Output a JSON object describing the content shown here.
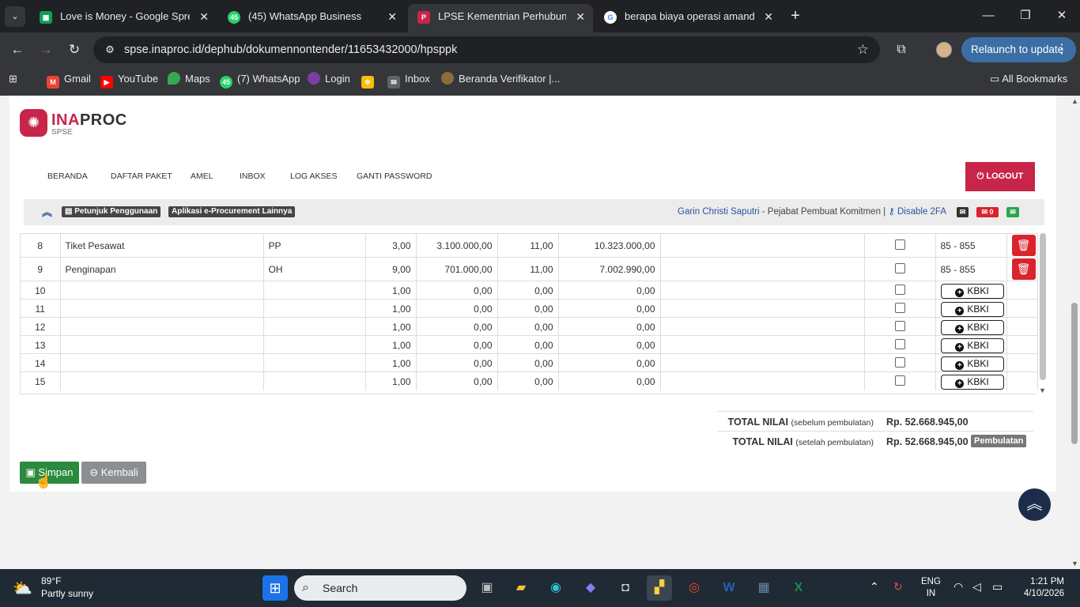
{
  "browser": {
    "tabs": [
      {
        "title": "Love is Money - Google Spread",
        "icon": "google-sheets-icon",
        "color": "#0f9d58"
      },
      {
        "title": "(45) WhatsApp Business",
        "icon": "whatsapp-icon",
        "badge": "45",
        "color": "#25d366"
      },
      {
        "title": "LPSE Kementrian Perhubungan",
        "icon": "lpse-icon",
        "color": "#c8254a",
        "active": true
      },
      {
        "title": "berapa biaya operasi amandel -",
        "icon": "google-icon",
        "color": "#4285f4"
      }
    ],
    "url": "spse.inaproc.id/dephub/dokumennontender/11653432000/hpsppk",
    "relaunch_label": "Relaunch to update",
    "bookmarks": [
      {
        "label": "Gmail",
        "icon": "gmail-icon"
      },
      {
        "label": "YouTube",
        "icon": "youtube-icon"
      },
      {
        "label": "Maps",
        "icon": "maps-icon"
      },
      {
        "label": "(7) WhatsApp",
        "icon": "whatsapp-icon",
        "badge": "45"
      },
      {
        "label": "Login",
        "icon": "login-icon"
      },
      {
        "label": "",
        "icon": "pinwheel-icon"
      },
      {
        "label": "Inbox",
        "icon": "mail-icon"
      },
      {
        "label": "Beranda Verifikator |...",
        "icon": "verifikator-icon"
      }
    ],
    "all_bookmarks_label": "All Bookmarks"
  },
  "header": {
    "logo_name_a": "INA",
    "logo_name_b": "PROC",
    "logo_sub": "SPSE",
    "nav": [
      "BERANDA",
      "DAFTAR PAKET",
      "AMEL",
      "INBOX",
      "LOG AKSES",
      "GANTI PASSWORD"
    ],
    "logout_label": "LOGOUT"
  },
  "infobar": {
    "petunjuk_label": "Petunjuk Penggunaan",
    "aplikasi_label": "Aplikasi e-Procurement Lainnya",
    "user_name": "Garin Christi Saputri",
    "user_role": " - Pejabat Pembuat Komitmen | ",
    "disable_2fa": "Disable 2FA",
    "mail_count": "0"
  },
  "table": {
    "rows": [
      {
        "no": "8",
        "item": "Tiket Pesawat",
        "unit": "PP",
        "vol": "3,00",
        "price": "3.100.000,00",
        "tax": "11,00",
        "total": "10.323.000,00",
        "kbki": "85 - 855",
        "action": "delete"
      },
      {
        "no": "9",
        "item": "Penginapan",
        "unit": "OH",
        "vol": "9,00",
        "price": "701.000,00",
        "tax": "11,00",
        "total": "7.002.990,00",
        "kbki": "85 - 855",
        "action": "delete"
      },
      {
        "no": "10",
        "item": "",
        "unit": "",
        "vol": "1,00",
        "price": "0,00",
        "tax": "0,00",
        "total": "0,00",
        "kbki": "KBKI",
        "action": "add"
      },
      {
        "no": "11",
        "item": "",
        "unit": "",
        "vol": "1,00",
        "price": "0,00",
        "tax": "0,00",
        "total": "0,00",
        "kbki": "KBKI",
        "action": "add"
      },
      {
        "no": "12",
        "item": "",
        "unit": "",
        "vol": "1,00",
        "price": "0,00",
        "tax": "0,00",
        "total": "0,00",
        "kbki": "KBKI",
        "action": "add"
      },
      {
        "no": "13",
        "item": "",
        "unit": "",
        "vol": "1,00",
        "price": "0,00",
        "tax": "0,00",
        "total": "0,00",
        "kbki": "KBKI",
        "action": "add"
      },
      {
        "no": "14",
        "item": "",
        "unit": "",
        "vol": "1,00",
        "price": "0,00",
        "tax": "0,00",
        "total": "0,00",
        "kbki": "KBKI",
        "action": "add"
      },
      {
        "no": "15",
        "item": "",
        "unit": "",
        "vol": "1,00",
        "price": "0,00",
        "tax": "0,00",
        "total": "0,00",
        "kbki": "KBKI",
        "action": "add"
      }
    ]
  },
  "totals": {
    "before_label": "TOTAL NILAI",
    "before_sub": "(sebelum pembulatan)",
    "before_value": "Rp. 52.668.945,00",
    "after_label": "TOTAL NILAI",
    "after_sub": "(setelah pembulatan)",
    "after_value": "Rp. 52.668.945,00",
    "pembulatan_label": "Pembulatan"
  },
  "actions": {
    "simpan_label": "Simpan",
    "kembali_label": "Kembali"
  },
  "taskbar": {
    "temp": "89°F",
    "condition": "Partly sunny",
    "search_placeholder": "Search",
    "lang_1": "ENG",
    "lang_2": "IN",
    "time": "1:21 PM",
    "date": "4/10/2026"
  }
}
